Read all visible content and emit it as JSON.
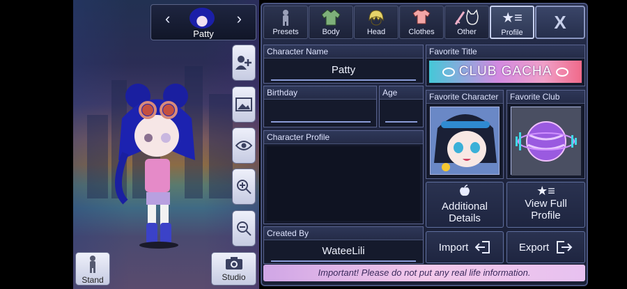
{
  "character_selector": {
    "name": "Patty",
    "prev_icon": "chevron-left-icon",
    "next_icon": "chevron-right-icon"
  },
  "side_tools": [
    {
      "name": "add-character-button",
      "icon": "add-person-icon"
    },
    {
      "name": "background-button",
      "icon": "image-icon"
    },
    {
      "name": "visibility-button",
      "icon": "eye-icon"
    },
    {
      "name": "zoom-in-button",
      "icon": "zoom-in-icon"
    },
    {
      "name": "zoom-out-button",
      "icon": "zoom-out-icon"
    }
  ],
  "bottom_buttons": {
    "stand": "Stand",
    "studio": "Studio"
  },
  "tabs": [
    {
      "label": "Presets",
      "icon": "person-silhouette-icon"
    },
    {
      "label": "Body",
      "icon": "jacket-icon"
    },
    {
      "label": "Head",
      "icon": "hair-icon"
    },
    {
      "label": "Clothes",
      "icon": "shirt-icon"
    },
    {
      "label": "Other",
      "icon": "sword-cat-icon"
    },
    {
      "label": "Profile",
      "icon": "star-list-icon"
    }
  ],
  "close_label": "X",
  "fields": {
    "character_name": {
      "label": "Character Name",
      "value": "Patty"
    },
    "birthday": {
      "label": "Birthday",
      "value": ""
    },
    "age": {
      "label": "Age",
      "value": ""
    },
    "character_profile": {
      "label": "Character Profile",
      "value": ""
    },
    "created_by": {
      "label": "Created By",
      "value": "WateeLili"
    }
  },
  "favorite_title": {
    "label": "Favorite Title",
    "value": "CLUB GACHA"
  },
  "favorite_character": {
    "label": "Favorite Character"
  },
  "favorite_club": {
    "label": "Favorite Club"
  },
  "actions": {
    "additional_details": "Additional Details",
    "view_full_profile": "View Full Profile",
    "import": "Import",
    "export": "Export"
  },
  "notice": "Important! Please do not put any real life information.",
  "colors": {
    "panel_bg": "#1a2036",
    "accent": "#8a9bd8",
    "notice_bg": "#f3c8ea"
  }
}
